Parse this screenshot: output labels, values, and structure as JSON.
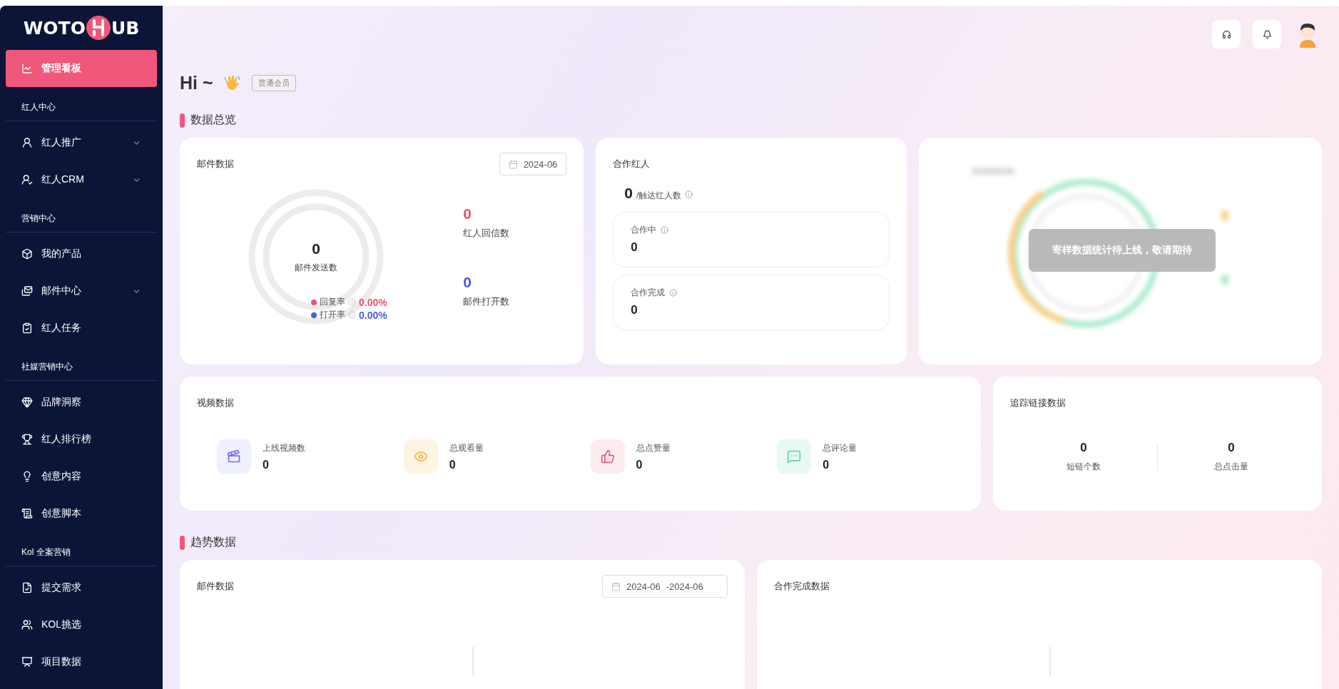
{
  "sidebar": {
    "logo": {
      "left": "WOTO",
      "right": "UB"
    },
    "top_item": {
      "label": "管理看板",
      "selected": true
    },
    "groups": [
      {
        "label": "红人中心",
        "items": [
          {
            "label": "红人推广",
            "selected": false,
            "collapsible": true
          },
          {
            "label": "红人CRM",
            "selected": false,
            "collapsible": true
          }
        ]
      },
      {
        "label": "营销中心",
        "items": [
          {
            "label": "我的产品",
            "selected": false,
            "collapsible": false
          },
          {
            "label": "邮件中心",
            "selected": false,
            "collapsible": true
          },
          {
            "label": "红人任务",
            "selected": false,
            "collapsible": false
          }
        ]
      },
      {
        "label": "社媒营销中心",
        "items": [
          {
            "label": "品牌洞察",
            "selected": false,
            "collapsible": false
          },
          {
            "label": "红人排行榜",
            "selected": false,
            "collapsible": false
          },
          {
            "label": "创意内容",
            "selected": false,
            "collapsible": false
          },
          {
            "label": "创意脚本",
            "selected": false,
            "collapsible": false
          }
        ]
      },
      {
        "label": "Kol 全案营销",
        "items": [
          {
            "label": "提交需求",
            "selected": false,
            "collapsible": false
          },
          {
            "label": "KOL挑选",
            "selected": false,
            "collapsible": false
          },
          {
            "label": "项目数据",
            "selected": false,
            "collapsible": false
          }
        ]
      }
    ]
  },
  "greeting": {
    "text": "Hi ~",
    "badge": "普通会员"
  },
  "overview": {
    "title": "数据总览",
    "mail": {
      "title": "邮件数据",
      "date": "2024-06",
      "center_value": "0",
      "center_label": "邮件发送数",
      "legend": [
        {
          "label": "回复率",
          "value": "0.00%",
          "color": "#f0506e"
        },
        {
          "label": "打开率",
          "value": "0.00%",
          "color": "#4b5de8"
        }
      ],
      "stats": [
        {
          "value": "0",
          "label": "红人回信数",
          "color": "#f0506e"
        },
        {
          "value": "0",
          "label": "邮件打开数",
          "color": "#4b5de8"
        }
      ]
    },
    "cooperation": {
      "title": "合作红人",
      "total": "0",
      "total_label": "/触达红人数",
      "boxes": [
        {
          "label": "合作中",
          "value": "0"
        },
        {
          "label": "合作完成",
          "value": "0"
        }
      ]
    },
    "sample": {
      "notice": "寄样数据统计待上线，敬请期待"
    },
    "video": {
      "title": "视频数据",
      "metrics": [
        {
          "label": "上线视频数",
          "value": "0"
        },
        {
          "label": "总观看量",
          "value": "0"
        },
        {
          "label": "总点赞量",
          "value": "0"
        },
        {
          "label": "总评论量",
          "value": "0"
        }
      ]
    },
    "tracking": {
      "title": "追踪链接数据",
      "stats": [
        {
          "value": "0",
          "label": "短链个数"
        },
        {
          "value": "0",
          "label": "总点击量"
        }
      ]
    }
  },
  "trends": {
    "title": "趋势数据",
    "mail": {
      "title": "邮件数据",
      "date_from": "2024-06",
      "date_to": "-2024-06"
    },
    "cooperation": {
      "title": "合作完成数据"
    }
  }
}
